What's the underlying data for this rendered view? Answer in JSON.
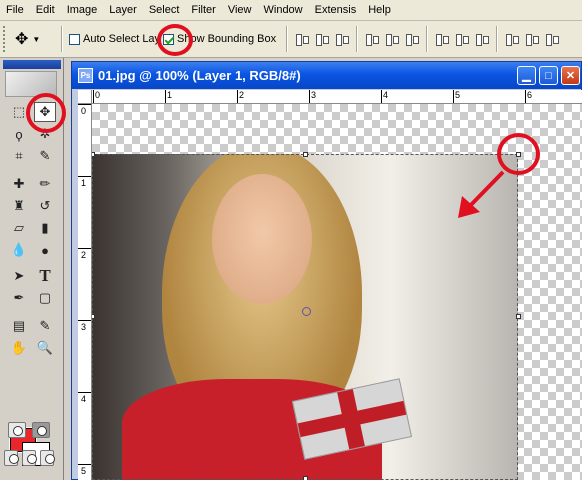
{
  "menu": [
    "File",
    "Edit",
    "Image",
    "Layer",
    "Select",
    "Filter",
    "View",
    "Window",
    "Extensis",
    "Help"
  ],
  "options": {
    "auto_select_label": "Auto Select Layer",
    "auto_select_checked": false,
    "show_bbox_label": "Show Bounding Box",
    "show_bbox_checked": true
  },
  "document": {
    "title": "01.jpg @ 100% (Layer 1, RGB/8#)",
    "zoom": "100%"
  },
  "ruler": {
    "top_ticks": [
      "0",
      "1",
      "2",
      "3",
      "4",
      "5",
      "6"
    ],
    "left_ticks": [
      "0",
      "1",
      "2",
      "3",
      "4",
      "5"
    ]
  },
  "colors": {
    "foreground": "#e8262b",
    "background": "#ffffff",
    "title_bar": "#0a55e3",
    "annotation": "#e01020"
  },
  "icons": [
    "move-tool-icon",
    "marquee-icon",
    "lasso-icon",
    "crop-icon",
    "eyedropper-icon",
    "healing-brush-icon",
    "brush-icon",
    "stamp-icon",
    "history-brush-icon",
    "eraser-icon",
    "gradient-icon",
    "blur-icon",
    "dodge-icon",
    "path-select-icon",
    "type-icon",
    "pen-icon",
    "shape-icon",
    "notes-icon",
    "hand-icon",
    "zoom-icon",
    "swap-colors-icon"
  ]
}
